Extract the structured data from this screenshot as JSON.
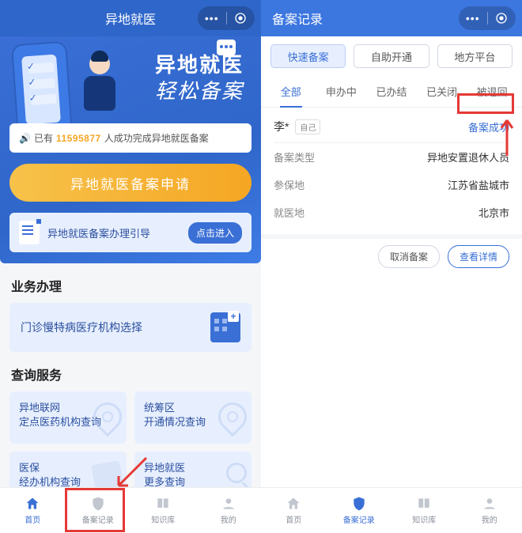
{
  "left": {
    "header_title": "异地就医",
    "hero_line1": "异地就医",
    "hero_line2": "轻松备案",
    "stat_prefix": "已有",
    "stat_count": "11595877",
    "stat_suffix": "人成功完成异地就医备案",
    "apply_label": "异地就医备案申请",
    "guide_text": "异地就医备案办理引导",
    "guide_btn": "点击进入",
    "section_biz": "业务办理",
    "biz_card": "门诊慢特病医疗机构选择",
    "section_query": "查询服务",
    "q1a": "异地联网",
    "q1b": "定点医药机构查询",
    "q2a": "统筹区",
    "q2b": "开通情况查询",
    "q3a": "医保",
    "q3b": "经办机构查询",
    "q4a": "异地就医",
    "q4b": "更多查询",
    "tabs": {
      "home": "首页",
      "record": "备案记录",
      "kb": "知识库",
      "mine": "我的"
    }
  },
  "right": {
    "header_title": "备案记录",
    "pills": {
      "fast": "快速备案",
      "self": "自助开通",
      "local": "地方平台"
    },
    "tabs": {
      "all": "全部",
      "processing": "申办中",
      "done": "已办结",
      "closed": "已关闭",
      "rejected": "被退回"
    },
    "rec": {
      "name": "李*",
      "relation": "自己",
      "status": "备案成功",
      "type_k": "备案类型",
      "type_v": "异地安置退休人员",
      "insured_k": "参保地",
      "insured_v": "江苏省盐城市",
      "med_k": "就医地",
      "med_v": "北京市"
    },
    "actions": {
      "cancel": "取消备案",
      "detail": "查看详情"
    },
    "tabs_bottom": {
      "home": "首页",
      "record": "备案记录",
      "kb": "知识库",
      "mine": "我的"
    }
  }
}
